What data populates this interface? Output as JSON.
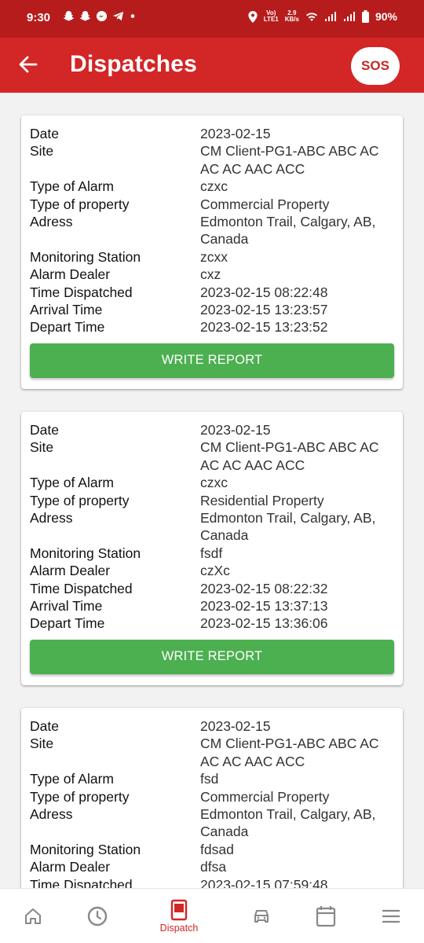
{
  "status_bar": {
    "time": "9:30",
    "left_icons": [
      "snapchat-icon",
      "snapchat-icon",
      "messenger-icon",
      "telegram-icon",
      "dot-icon"
    ],
    "volte_top": "Vo)",
    "volte_bottom": "LTE1",
    "speed_top": "2.9",
    "speed_bottom": "KB/s",
    "battery": "90%"
  },
  "app_bar": {
    "title": "Dispatches",
    "sos_label": "SOS"
  },
  "colors": {
    "status_bar": "#b71c1c",
    "app_bar": "#d32626",
    "button_green": "#4caf50",
    "nav_active": "#d32626"
  },
  "labels": {
    "date": "Date",
    "site": "Site",
    "alarm_type": "Type of Alarm",
    "property_type": "Type of property",
    "address": "Adress",
    "monitoring_station": "Monitoring Station",
    "alarm_dealer": "Alarm Dealer",
    "time_dispatched": "Time Dispatched",
    "arrival_time": "Arrival Time",
    "depart_time": "Depart Time"
  },
  "write_report_label": "WRITE REPORT",
  "dispatches": [
    {
      "date": "2023-02-15",
      "site": "CM Client-PG1-ABC ABC AC AC AC AAC ACC",
      "alarm_type": "czxc",
      "property_type": "Commercial Property",
      "address": "Edmonton Trail, Calgary, AB, Canada",
      "monitoring_station": "zcxx",
      "alarm_dealer": "cxz",
      "time_dispatched": "2023-02-15 08:22:48",
      "arrival_time": "2023-02-15 13:23:57",
      "depart_time": "2023-02-15 13:23:52"
    },
    {
      "date": "2023-02-15",
      "site": "CM Client-PG1-ABC ABC AC AC AC AAC ACC",
      "alarm_type": "czxc",
      "property_type": "Residential Property",
      "address": "Edmonton Trail, Calgary, AB, Canada",
      "monitoring_station": "fsdf",
      "alarm_dealer": "czXc",
      "time_dispatched": "2023-02-15 08:22:32",
      "arrival_time": "2023-02-15 13:37:13",
      "depart_time": "2023-02-15 13:36:06"
    },
    {
      "date": "2023-02-15",
      "site": "CM Client-PG1-ABC ABC AC AC AC AAC ACC",
      "alarm_type": "fsd",
      "property_type": "Commercial Property",
      "address": "Edmonton Trail, Calgary, AB, Canada",
      "monitoring_station": "fdsad",
      "alarm_dealer": "dfsa",
      "time_dispatched": "2023-02-15 07:59:48"
    }
  ],
  "bottom_nav": {
    "items": [
      {
        "icon": "home-icon"
      },
      {
        "icon": "clock-icon"
      },
      {
        "icon": "dispatch-icon",
        "label": "Dispatch",
        "active": true
      },
      {
        "icon": "car-icon"
      },
      {
        "icon": "calendar-icon"
      },
      {
        "icon": "menu-icon"
      }
    ]
  }
}
